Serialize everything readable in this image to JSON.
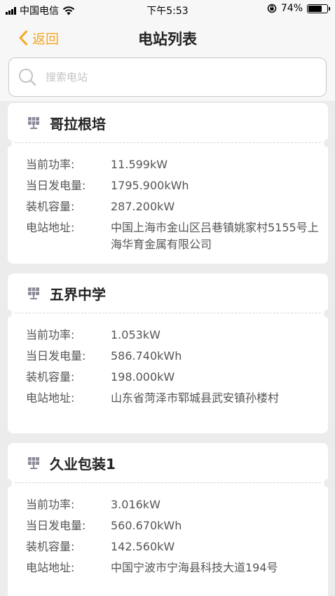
{
  "status_bar": {
    "carrier": "中国电信",
    "time": "下午5:53",
    "battery_percent": "74%",
    "battery_level": 0.74
  },
  "nav": {
    "back_label": "返回",
    "title": "电站列表"
  },
  "search": {
    "placeholder": "搜索电站"
  },
  "labels": {
    "power": "当前功率:",
    "daily_energy": "当日发电量:",
    "capacity": "装机容量:",
    "address": "电站地址:"
  },
  "stations": [
    {
      "name": "哥拉根培",
      "power": "11.599kW",
      "daily_energy": "1795.900kWh",
      "capacity": "287.200kW",
      "address": "中国上海市金山区吕巷镇姚家村5155号上海华育金属有限公司"
    },
    {
      "name": "五界中学",
      "power": "1.053kW",
      "daily_energy": "586.740kWh",
      "capacity": "198.000kW",
      "address": "山东省菏泽市郓城县武安镇孙楼村"
    },
    {
      "name": "久业包装1",
      "power": "3.016kW",
      "daily_energy": "560.670kWh",
      "capacity": "142.560kW",
      "address": "中国宁波市宁海县科技大道194号"
    }
  ],
  "colors": {
    "accent": "#f5a623",
    "background": "#ececec",
    "card": "#ffffff"
  },
  "icons": {
    "back": "chevron-left-icon",
    "search": "search-icon",
    "station": "solar-panel-icon"
  }
}
